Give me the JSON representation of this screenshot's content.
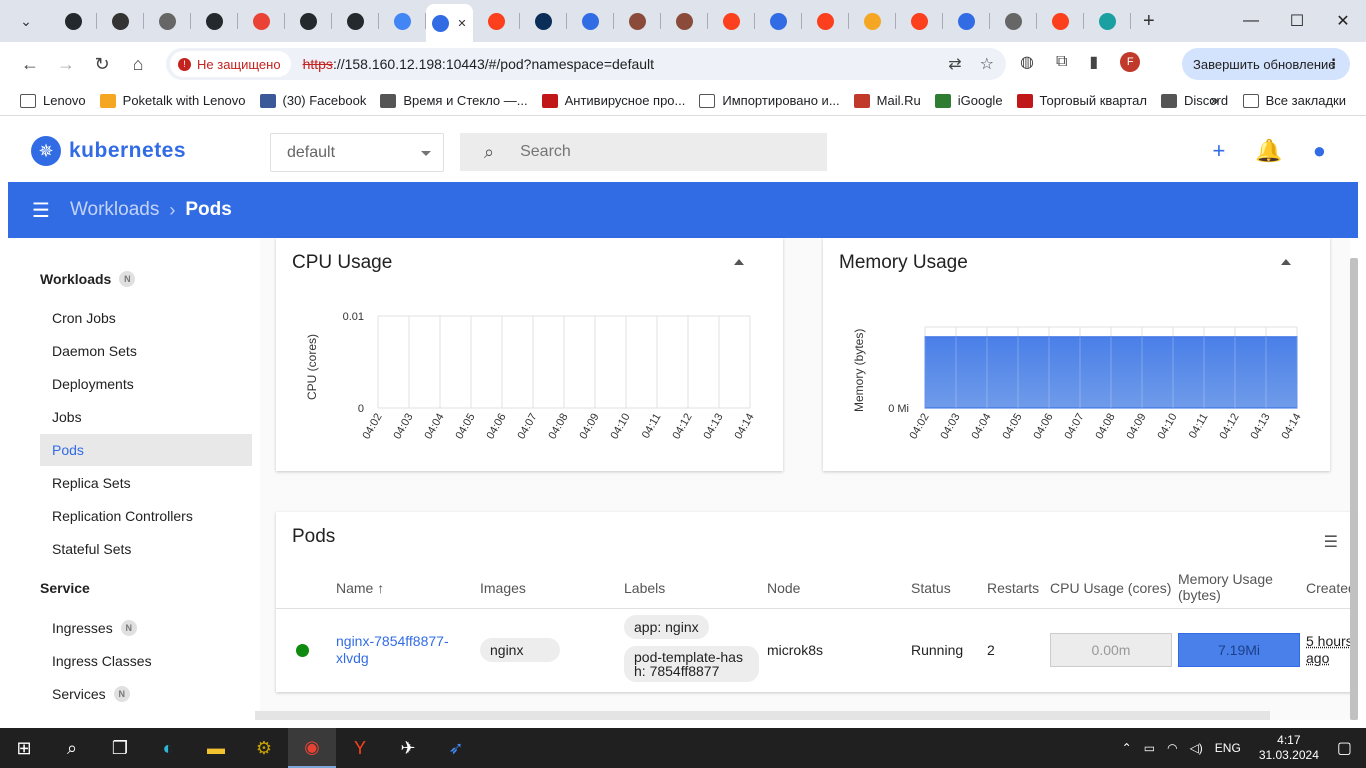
{
  "browser": {
    "tabs": [
      {
        "icon": "github-icon",
        "color": "#24292e"
      },
      {
        "icon": "apps-icon",
        "color": "#333333"
      },
      {
        "icon": "globe-icon",
        "color": "#666666"
      },
      {
        "icon": "github-icon",
        "color": "#24292e"
      },
      {
        "icon": "gmail-icon",
        "color": "#ea4335"
      },
      {
        "icon": "github-icon",
        "color": "#24292e"
      },
      {
        "icon": "github-icon",
        "color": "#24292e"
      },
      {
        "icon": "circle-c-icon",
        "color": "#4285f4"
      },
      {
        "icon": "k8s-icon",
        "color": "#326ce5",
        "active": true
      },
      {
        "icon": "yandex-icon",
        "color": "#fc3f1d"
      },
      {
        "icon": "sde-icon",
        "color": "#0b2e59"
      },
      {
        "icon": "k8s-icon",
        "color": "#326ce5"
      },
      {
        "icon": "avatar-icon",
        "color": "#8a4b3a"
      },
      {
        "icon": "avatar-icon",
        "color": "#8a4b3a"
      },
      {
        "icon": "yandex-icon",
        "color": "#fc3f1d"
      },
      {
        "icon": "k8s-icon",
        "color": "#326ce5"
      },
      {
        "icon": "yandex-icon",
        "color": "#fc3f1d"
      },
      {
        "icon": "lt-icon",
        "color": "#f5a623"
      },
      {
        "icon": "yandex-icon",
        "color": "#fc3f1d"
      },
      {
        "icon": "k8s-icon",
        "color": "#326ce5"
      },
      {
        "icon": "globe-icon",
        "color": "#666666"
      },
      {
        "icon": "yandex-icon",
        "color": "#fc3f1d"
      },
      {
        "icon": "puzzle-icon",
        "color": "#1aa0a0"
      }
    ],
    "insecure_label": "Не защищено",
    "url_scheme": "https",
    "url_rest": "://158.160.12.198:10443/#/pod?namespace=default",
    "profile_initial": "F",
    "update_label": "Завершить обновление",
    "bookmarks": [
      {
        "label": "Lenovo",
        "icon": "folder-icon"
      },
      {
        "label": "Poketalk with Lenovo",
        "icon": "poketalk-icon"
      },
      {
        "label": "(30) Facebook",
        "icon": "facebook-icon"
      },
      {
        "label": "Время и Стекло —...",
        "icon": "globe-icon"
      },
      {
        "label": "Антивирусное про...",
        "icon": "mcafee-icon"
      },
      {
        "label": "Импортировано и...",
        "icon": "folder-icon"
      },
      {
        "label": "Mail.Ru",
        "icon": "mailru-icon"
      },
      {
        "label": "iGoogle",
        "icon": "igoogle-icon"
      },
      {
        "label": "Торговый квартал",
        "icon": "mcafee-icon"
      },
      {
        "label": "Discord",
        "icon": "globe-icon"
      }
    ],
    "all_bookmarks": "Все закладки"
  },
  "k8s": {
    "brand": "kubernetes",
    "namespace": "default",
    "search_placeholder": "Search",
    "breadcrumb": {
      "parent": "Workloads",
      "current": "Pods"
    },
    "sidebar": {
      "workloads_title": "Workloads",
      "workloads_badge": "N",
      "workloads": [
        "Cron Jobs",
        "Daemon Sets",
        "Deployments",
        "Jobs",
        "Pods",
        "Replica Sets",
        "Replication Controllers",
        "Stateful Sets"
      ],
      "active": "Pods",
      "service_title": "Service",
      "service": [
        {
          "label": "Ingresses",
          "badge": "N"
        },
        {
          "label": "Ingress Classes",
          "badge": ""
        },
        {
          "label": "Services",
          "badge": "N"
        }
      ]
    },
    "cpu_card": {
      "title": "CPU Usage"
    },
    "mem_card": {
      "title": "Memory Usage"
    },
    "pods_card": {
      "title": "Pods",
      "columns": {
        "name": "Name",
        "sort_arrow": "↑",
        "images": "Images",
        "labels": "Labels",
        "node": "Node",
        "status": "Status",
        "restarts": "Restarts",
        "cpu": "CPU Usage (cores)",
        "mem_line1": "Memory Usage",
        "mem_line2": "(bytes)",
        "created": "Created"
      },
      "row": {
        "name_line1": "nginx-7854ff8877-",
        "name_line2": "xlvdg",
        "image": "nginx",
        "label1": "app: nginx",
        "label2_line1": "pod-template-has",
        "label2_line2": "h: 7854ff8877",
        "node": "microk8s",
        "status": "Running",
        "restarts": "2",
        "cpu": "0.00m",
        "mem": "7.19Mi",
        "created_line1": "5 hours",
        "created_line2": "ago"
      }
    }
  },
  "chart_data": [
    {
      "type": "line",
      "title": "CPU Usage",
      "ylabel": "CPU (cores)",
      "x": [
        "04:02",
        "04:03",
        "04:04",
        "04:05",
        "04:06",
        "04:07",
        "04:08",
        "04:09",
        "04:10",
        "04:11",
        "04:12",
        "04:13",
        "04:14"
      ],
      "yticks": [
        "0",
        "0.01"
      ],
      "ylim": [
        0,
        0.01
      ],
      "series": [
        {
          "values": [
            0,
            0,
            0,
            0,
            0,
            0,
            0,
            0,
            0,
            0,
            0,
            0,
            0
          ]
        }
      ],
      "grid": true
    },
    {
      "type": "area",
      "title": "Memory Usage",
      "ylabel": "Memory (bytes)",
      "x": [
        "04:02",
        "04:03",
        "04:04",
        "04:05",
        "04:06",
        "04:07",
        "04:08",
        "04:09",
        "04:10",
        "04:11",
        "04:12",
        "04:13",
        "04:14"
      ],
      "yticks": [
        "0 Mi"
      ],
      "series": [
        {
          "values": [
            7.19,
            7.19,
            7.19,
            7.19,
            7.19,
            7.19,
            7.19,
            7.19,
            7.19,
            7.19,
            7.19,
            7.19,
            7.19
          ],
          "color": "#6f9be9"
        }
      ],
      "grid": true
    }
  ],
  "taskbar": {
    "apps": [
      {
        "icon": "windows-icon"
      },
      {
        "icon": "search-icon"
      },
      {
        "icon": "task-view-icon"
      },
      {
        "icon": "edge-icon"
      },
      {
        "icon": "explorer-icon"
      },
      {
        "icon": "network-app-icon"
      },
      {
        "icon": "chrome-icon",
        "active": true
      },
      {
        "icon": "yandex-browser-icon"
      },
      {
        "icon": "satellite-icon"
      },
      {
        "icon": "ski-icon"
      }
    ],
    "lang": "ENG",
    "time": "4:17",
    "date": "31.03.2024"
  }
}
